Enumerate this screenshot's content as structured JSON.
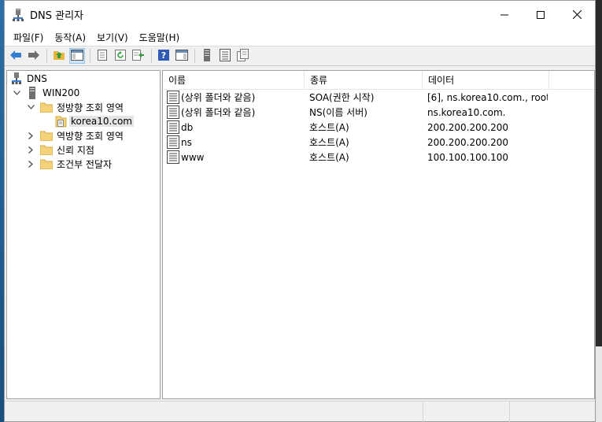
{
  "window": {
    "title": "DNS 관리자",
    "icon": "dns-server-icon"
  },
  "menu": [
    {
      "label": "파일(F)"
    },
    {
      "label": "동작(A)"
    },
    {
      "label": "보기(V)"
    },
    {
      "label": "도움말(H)"
    }
  ],
  "toolbar": {
    "buttons": [
      "back-icon",
      "forward-icon",
      "up-folder-icon",
      "show-hide-tree-icon",
      "properties-icon",
      "refresh-icon",
      "export-list-icon",
      "help-icon",
      "show-action-pane-icon",
      "server-icon",
      "records-list-icon",
      "copy-icon"
    ]
  },
  "tree": {
    "root": "DNS",
    "server": "WIN200",
    "forward_zones": "정방향 조회 영역",
    "zone": "korea10.com",
    "reverse_zones": "역방향 조회 영역",
    "trust_points": "신뢰 지점",
    "conditional_forwarders": "조건부 전달자"
  },
  "table": {
    "headers": [
      "이름",
      "종류",
      "데이터"
    ],
    "rows": [
      {
        "name": "(상위 폴더와 같음)",
        "type": "SOA(권한 시작)",
        "data": "[6], ns.korea10.com., root…"
      },
      {
        "name": "(상위 폴더와 같음)",
        "type": "NS(이름 서버)",
        "data": "ns.korea10.com."
      },
      {
        "name": "db",
        "type": "호스트(A)",
        "data": "200.200.200.200"
      },
      {
        "name": "ns",
        "type": "호스트(A)",
        "data": "200.200.200.200"
      },
      {
        "name": "www",
        "type": "호스트(A)",
        "data": "100.100.100.100"
      }
    ]
  },
  "colors": {
    "selection": "#e5e5e5",
    "folder": "#f5d27a",
    "toolbar_active": "#cce4f7"
  }
}
